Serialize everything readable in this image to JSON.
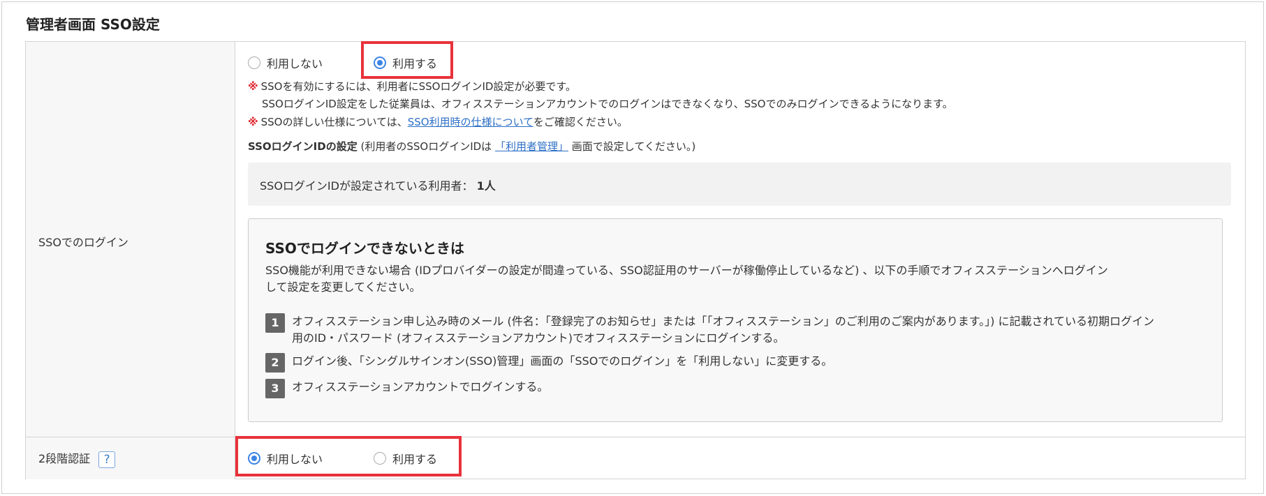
{
  "page": {
    "title": "管理者画面 SSO設定"
  },
  "sso_login": {
    "label": "SSOでのログイン",
    "options": [
      "利用しない",
      "利用する"
    ],
    "selected": "利用する",
    "note1_line1": "SSOを有効にするには、利用者にSSOログインID設定が必要です。",
    "note1_line2": "SSOログインID設定をした従業員は、オフィスステーションアカウントでのログインはできなくなり、SSOでのみログインできるようになります。",
    "note_mark": "※",
    "note2_prefix": "SSOの詳しい仕様については、",
    "note2_link": "SSO利用時の仕様について",
    "note2_suffix": "をご確認ください。",
    "id_setting_heading": "SSOログインIDの設定",
    "id_setting_paren_prefix": "(利用者のSSOログインIDは",
    "id_setting_link": "「利用者管理」",
    "id_setting_paren_suffix": "画面で設定してください。)",
    "count_label": "SSOログインIDが設定されている利用者：",
    "count_value": "1人"
  },
  "guide": {
    "title": "SSOでログインできないときは",
    "desc_line1": "SSO機能が利用できない場合 (IDプロバイダーの設定が間違っている、SSO認証用のサーバーが稼働停止しているなど) 、以下の手順でオフィスステーションへログイン",
    "desc_line2": "して設定を変更してください。",
    "steps": [
      {
        "num": "1",
        "line1": "オフィスステーション申し込み時のメール (件名：「登録完了のお知らせ」または「「オフィスステーション」のご利用のご案内があります。」) に記載されている初期ログイン",
        "line2": "用のID・パスワード (オフィスステーションアカウント)でオフィスステーションにログインする。"
      },
      {
        "num": "2",
        "line1": "ログイン後、「シングルサインオン(SSO)管理」画面の「SSOでのログイン」を「利用しない」に変更する。"
      },
      {
        "num": "3",
        "line1": "オフィスステーションアカウントでログインする。"
      }
    ]
  },
  "two_factor": {
    "label": "2段階認証",
    "help_icon": "?",
    "options": [
      "利用しない",
      "利用する"
    ],
    "selected": "利用しない"
  },
  "colors": {
    "highlight": "#e8323c",
    "radio_accent": "#3b84e6",
    "link": "#2d6fc6",
    "note_mark": "#e0272f"
  }
}
